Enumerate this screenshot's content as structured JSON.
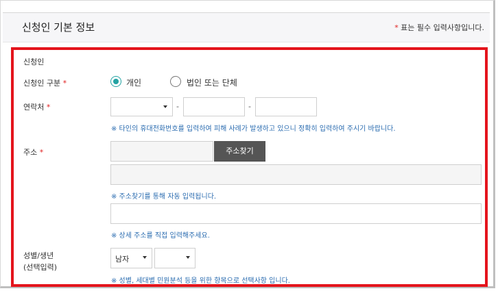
{
  "header": {
    "title": "신청인 기본 정보",
    "required_mark": "*",
    "note": " 표는 필수 입력사항입니다."
  },
  "section": {
    "title": "신청인"
  },
  "applicant_type": {
    "label": "신청인 구분",
    "required_mark": "*",
    "options": [
      {
        "label": "개인",
        "selected": true
      },
      {
        "label": "법인 또는 단체",
        "selected": false
      }
    ]
  },
  "contact": {
    "label": "연락처",
    "required_mark": "*",
    "separator": "-",
    "hint": "※ 타인의 휴대전화번호를 입력하여 피해 사례가 발생하고 있으니 정확히 입력하여 주시기 바랍니다."
  },
  "address": {
    "label": "주소",
    "required_mark": "*",
    "search_button": "주소찾기",
    "hint_auto": "※ 주소찾기를 통해 자동 입력됩니다.",
    "hint_detail": "※ 상세 주소를 직접 입력해주세요."
  },
  "gender_birth": {
    "label_line1": "성별/생년",
    "label_line2": "(선택입력)",
    "gender_value": "남자",
    "hint": "※ 성별, 세대별 민원분석 등을 위한 항목으로 선택사항 입니다."
  },
  "colors": {
    "accent": "#23a3a3",
    "highlight_border": "#e4141c",
    "hint": "#2b6cb0",
    "required": "#e02020"
  }
}
